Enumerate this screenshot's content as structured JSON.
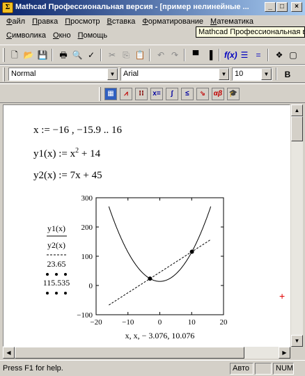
{
  "window": {
    "title": "Mathcad Профессиональная версия - [пример нелинейные ...",
    "minimize": "_",
    "maximize": "□",
    "close": "×"
  },
  "menu": {
    "row1": [
      "Файл",
      "Правка",
      "Просмотр",
      "Вставка",
      "Форматирование",
      "Математика"
    ],
    "row2": [
      "Символика",
      "Окно",
      "Помощь"
    ]
  },
  "tooltip": "Mathcad Профессиональная ве",
  "format_toolbar": {
    "style": "Normal",
    "font": "Arial",
    "size": "10",
    "bold": "B"
  },
  "math_toolbar": {
    "buttons": [
      "calculator-icon",
      "graph-icon",
      "matrix-icon",
      "evaluation-icon",
      "calculus-icon",
      "boolean-icon",
      "programming-icon",
      "greek-icon",
      "symbolic-icon"
    ]
  },
  "worksheet": {
    "line1": "x := −16 , −15.9 .. 16",
    "line2_prefix": "y1(x) := x",
    "line2_exp": "2",
    "line2_suffix": " + 14",
    "line3": "y2(x) := 7x + 45"
  },
  "chart_data": {
    "type": "line",
    "title": "",
    "ylabel_lines": [
      "y1(x)",
      "y2(x)",
      "23.65",
      "115.535"
    ],
    "xlabel": "x, x, − 3.076, 10.076",
    "xlim": [
      -20,
      20
    ],
    "ylim": [
      -100,
      300
    ],
    "xticks": [
      -20,
      -10,
      0,
      10,
      20
    ],
    "yticks": [
      -100,
      0,
      100,
      200,
      300
    ],
    "series": [
      {
        "label": "y1(x) = x^2 + 14",
        "style": "solid",
        "x_range": [
          -16,
          16
        ],
        "formula": "x^2+14"
      },
      {
        "label": "y2(x) = 7x + 45",
        "style": "dashed",
        "x_range": [
          -16,
          16
        ],
        "formula": "7x+45"
      }
    ],
    "points": [
      {
        "x": -3.076,
        "y": 23.65
      },
      {
        "x": 10.076,
        "y": 115.535
      }
    ]
  },
  "status": {
    "help": "Press F1 for help.",
    "mode": "Авто",
    "num": "NUM"
  }
}
